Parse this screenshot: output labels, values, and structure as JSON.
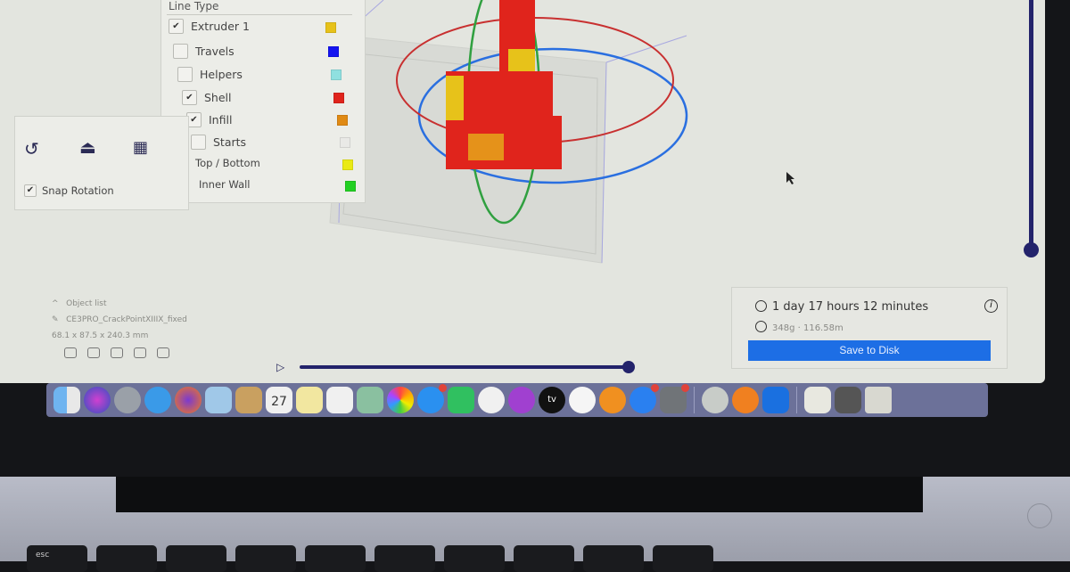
{
  "line_type": {
    "title": "Line Type",
    "items": [
      {
        "label": "Extruder 1",
        "checked": true,
        "color": "#e7c21a"
      },
      {
        "label": "Travels",
        "checked": false,
        "color": "#1414f0"
      },
      {
        "label": "Helpers",
        "checked": false,
        "color": "#8fe0e0"
      },
      {
        "label": "Shell",
        "checked": true,
        "color": "#e0241c"
      },
      {
        "label": "Infill",
        "checked": true,
        "color": "#e08a14"
      },
      {
        "label": "Starts",
        "checked": false,
        "color": "#e9e9e6"
      },
      {
        "label": "Top / Bottom",
        "color": "#eaea14"
      },
      {
        "label": "Inner Wall",
        "color": "#22d022"
      }
    ]
  },
  "rotate_tool": {
    "snap_label": "Snap Rotation",
    "snap_checked": true,
    "icons": [
      "reset-rotation-icon",
      "lay-flat-icon",
      "select-face-icon"
    ]
  },
  "object_list": {
    "header": "Object list",
    "name": "CE3PRO_CrackPointXIIIX_fixed",
    "dimensions": "68.1 x 87.5 x 240.3 mm"
  },
  "print_info": {
    "time": "1 day 17 hours 12 minutes",
    "material": "348g · 116.58m",
    "save_label": "Save to Disk"
  },
  "dock": {
    "icons": [
      "finder",
      "siri",
      "launchpad",
      "safari",
      "firefox",
      "preview",
      "notes-app",
      "calendar",
      "stickies",
      "reminders",
      "maps",
      "photos",
      "messages",
      "facetime",
      "music",
      "podcasts",
      "apple-tv",
      "news",
      "books",
      "app-store",
      "system-preferences",
      "eye-app",
      "blender",
      "cura",
      "documents",
      "screenshot",
      "trash"
    ],
    "calendar_date": "27",
    "apple_tv_label": "tv"
  },
  "keyboard": {
    "esc_label": "esc"
  },
  "colors": {
    "accent": "#1d6ee5",
    "slider": "#23236b",
    "model": "#e0241c"
  }
}
